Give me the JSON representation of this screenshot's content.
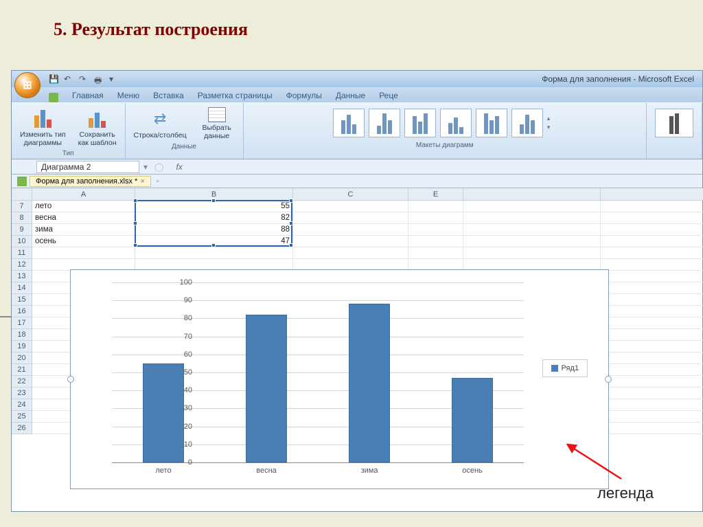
{
  "slide": {
    "title": "5. Результат построения"
  },
  "window_title": "Форма для заполнения - Microsoft Excel",
  "tabs": {
    "left_btn": "",
    "items": [
      "Главная",
      "Меню",
      "Вставка",
      "Разметка страницы",
      "Формулы",
      "Данные",
      "Реце"
    ]
  },
  "ribbon": {
    "type_group": {
      "change_type": "Изменить тип\nдиаграммы",
      "save_template": "Сохранить\nкак шаблон",
      "label": "Тип"
    },
    "data_group": {
      "switch_rc": "Строка/столбец",
      "select_data": "Выбрать\nданные",
      "label": "Данные"
    },
    "layouts_group": {
      "label": "Макеты диаграмм"
    }
  },
  "name_box": "Диаграмма 2",
  "doc_tab": "Форма для заполнения.xlsx *",
  "columns": [
    "A",
    "B",
    "C",
    "E"
  ],
  "rows_start": 7,
  "rows_end": 26,
  "data_cells": {
    "A7": "лето",
    "B7": "55",
    "A8": "весна",
    "B8": "82",
    "A9": "зима",
    "B9": "88",
    "A10": "осень",
    "B10": "47"
  },
  "chart_data": {
    "type": "bar",
    "categories": [
      "лето",
      "весна",
      "зима",
      "осень"
    ],
    "values": [
      55,
      82,
      88,
      47
    ],
    "series_name": "Ряд1",
    "ylim": [
      0,
      100
    ],
    "y_step": 10,
    "colors": {
      "bar": "#4a7fb5"
    }
  },
  "annotation": "легенда"
}
